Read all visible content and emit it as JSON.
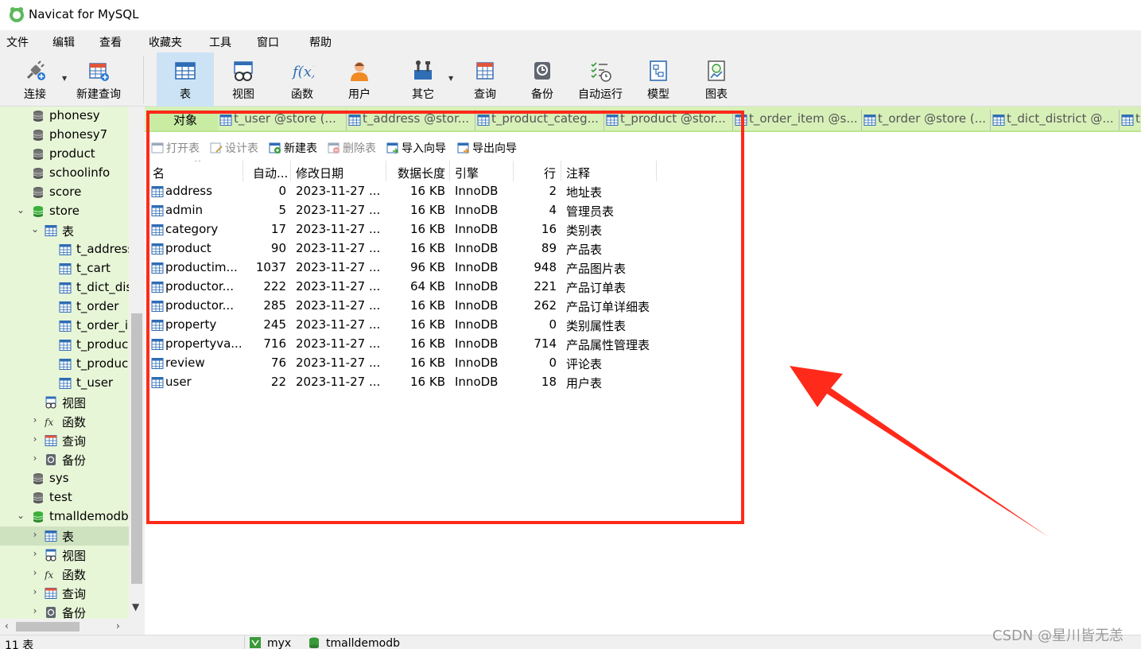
{
  "window": {
    "title": "Navicat for MySQL"
  },
  "menu": [
    "文件",
    "编辑",
    "查看",
    "收藏夹",
    "工具",
    "窗口",
    "帮助"
  ],
  "toolbar": {
    "connect": "连接",
    "new_query": "新建查询",
    "table": "表",
    "view": "视图",
    "function": "函数",
    "user": "用户",
    "other": "其它",
    "query": "查询",
    "backup": "备份",
    "autorun": "自动运行",
    "model": "模型",
    "chart": "图表"
  },
  "sidebar": {
    "items": [
      {
        "label": "phonesy"
      },
      {
        "label": "phonesy7"
      },
      {
        "label": "product"
      },
      {
        "label": "schoolinfo"
      },
      {
        "label": "score"
      },
      {
        "label": "store"
      },
      {
        "label": "表"
      },
      {
        "label": "t_address"
      },
      {
        "label": "t_cart"
      },
      {
        "label": "t_dict_dis"
      },
      {
        "label": "t_order"
      },
      {
        "label": "t_order_i"
      },
      {
        "label": "t_produc"
      },
      {
        "label": "t_produc"
      },
      {
        "label": "t_user"
      },
      {
        "label": "视图"
      },
      {
        "label": "函数"
      },
      {
        "label": "查询"
      },
      {
        "label": "备份"
      },
      {
        "label": "sys"
      },
      {
        "label": "test"
      },
      {
        "label": "tmalldemodb"
      },
      {
        "label": "表"
      },
      {
        "label": "视图"
      },
      {
        "label": "函数"
      },
      {
        "label": "查询"
      },
      {
        "label": "备份"
      }
    ]
  },
  "tabs": [
    {
      "label": "对象"
    },
    {
      "label": "t_user @store (..."
    },
    {
      "label": "t_address @stor..."
    },
    {
      "label": "t_product_categ..."
    },
    {
      "label": "t_product @stor..."
    },
    {
      "label": "t_order_item @s..."
    },
    {
      "label": "t_order @store (..."
    },
    {
      "label": "t_dict_district @..."
    },
    {
      "label": "t..."
    }
  ],
  "object_toolbar": {
    "open": "打开表",
    "design": "设计表",
    "new": "新建表",
    "delete": "删除表",
    "import": "导入向导",
    "export": "导出向导"
  },
  "grid": {
    "columns": [
      "名",
      "自动...",
      "修改日期",
      "数据长度",
      "引擎",
      "行",
      "注释"
    ],
    "rows": [
      {
        "name": "address",
        "auto": "0",
        "date": "2023-11-27 ...",
        "size": "16 KB",
        "engine": "InnoDB",
        "rows": "2",
        "comment": "地址表"
      },
      {
        "name": "admin",
        "auto": "5",
        "date": "2023-11-27 ...",
        "size": "16 KB",
        "engine": "InnoDB",
        "rows": "4",
        "comment": "管理员表"
      },
      {
        "name": "category",
        "auto": "17",
        "date": "2023-11-27 ...",
        "size": "16 KB",
        "engine": "InnoDB",
        "rows": "16",
        "comment": "类别表"
      },
      {
        "name": "product",
        "auto": "90",
        "date": "2023-11-27 ...",
        "size": "16 KB",
        "engine": "InnoDB",
        "rows": "89",
        "comment": "产品表"
      },
      {
        "name": "productim...",
        "auto": "1037",
        "date": "2023-11-27 ...",
        "size": "96 KB",
        "engine": "InnoDB",
        "rows": "948",
        "comment": "产品图片表"
      },
      {
        "name": "productor...",
        "auto": "222",
        "date": "2023-11-27 ...",
        "size": "64 KB",
        "engine": "InnoDB",
        "rows": "221",
        "comment": "产品订单表"
      },
      {
        "name": "productor...",
        "auto": "285",
        "date": "2023-11-27 ...",
        "size": "16 KB",
        "engine": "InnoDB",
        "rows": "262",
        "comment": "产品订单详细表"
      },
      {
        "name": "property",
        "auto": "245",
        "date": "2023-11-27 ...",
        "size": "16 KB",
        "engine": "InnoDB",
        "rows": "0",
        "comment": "类别属性表"
      },
      {
        "name": "propertyva...",
        "auto": "716",
        "date": "2023-11-27 ...",
        "size": "16 KB",
        "engine": "InnoDB",
        "rows": "714",
        "comment": "产品属性管理表"
      },
      {
        "name": "review",
        "auto": "76",
        "date": "2023-11-27 ...",
        "size": "16 KB",
        "engine": "InnoDB",
        "rows": "0",
        "comment": "评论表"
      },
      {
        "name": "user",
        "auto": "22",
        "date": "2023-11-27 ...",
        "size": "16 KB",
        "engine": "InnoDB",
        "rows": "18",
        "comment": "用户表"
      }
    ]
  },
  "status": {
    "count": "11 表",
    "connection": "myx",
    "database": "tmalldemodb"
  },
  "watermark": "CSDN @星川皆无恙",
  "colors": {
    "sidebar_bg": "#e8f6d8",
    "tab_bar_bg": "#d7f0b8",
    "annotation_red": "#ff2a1a",
    "toolbar_active": "#cce3f5"
  }
}
